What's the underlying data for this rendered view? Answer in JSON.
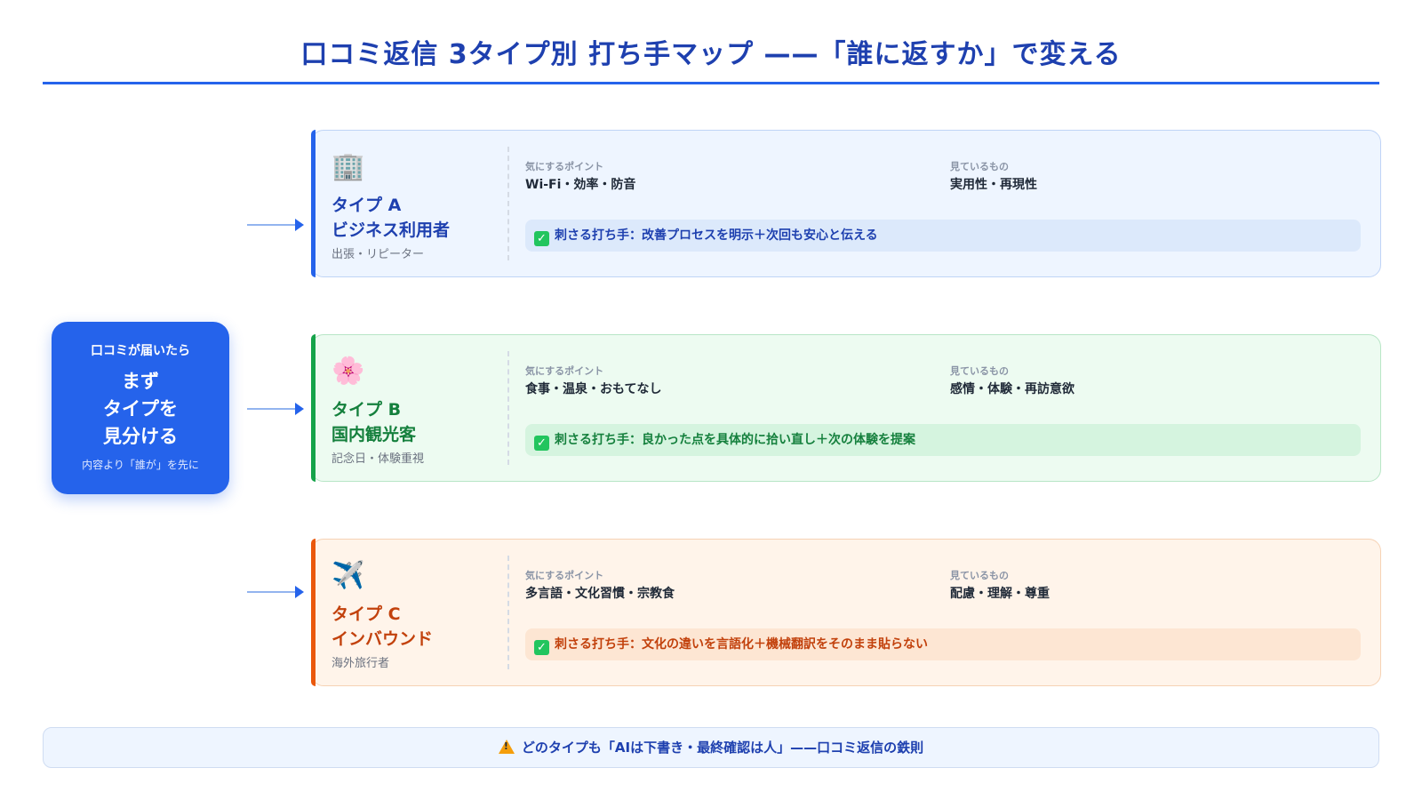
{
  "title": "口コミ返信 3タイプ別 打ち手マップ ——「誰に返すか」で変える",
  "hub": {
    "small": "口コミが届いたら",
    "main": [
      "まず",
      "タイプを",
      "見分ける"
    ],
    "note": "内容より「誰が」を先に"
  },
  "labels": {
    "concern": "気にするポイント",
    "watching": "見ているもの"
  },
  "types": [
    {
      "icon": "🏢",
      "icon_name": "office-building-icon",
      "name": "タイプ A",
      "audience": "ビジネス利用者",
      "sub": "出張・リピーター",
      "concern": "Wi-Fi・効率・防音",
      "watching": "実用性・再現性",
      "punch": "刺さる打ち手：改善プロセスを明示＋次回も安心と伝える",
      "accent": "#2563eb"
    },
    {
      "icon": "🌸",
      "icon_name": "cherry-blossom-icon",
      "name": "タイプ B",
      "audience": "国内観光客",
      "sub": "記念日・体験重視",
      "concern": "食事・温泉・おもてなし",
      "watching": "感情・体験・再訪意欲",
      "punch": "刺さる打ち手：良かった点を具体的に拾い直し＋次の体験を提案",
      "accent": "#16a34a"
    },
    {
      "icon": "✈️",
      "icon_name": "airplane-icon",
      "name": "タイプ C",
      "audience": "インバウンド",
      "sub": "海外旅行者",
      "concern": "多言語・文化習慣・宗教食",
      "watching": "配慮・理解・尊重",
      "punch": "刺さる打ち手：文化の違いを言語化＋機械翻訳をそのまま貼らない",
      "accent": "#ea580c"
    }
  ],
  "footer": "どのタイプも「AIは下書き・最終確認は人」——口コミ返信の鉄則"
}
